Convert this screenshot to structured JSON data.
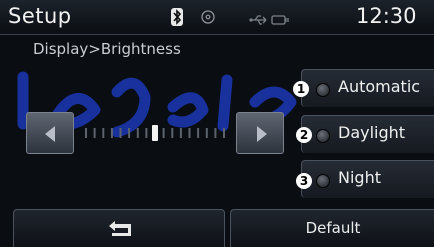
{
  "header": {
    "title": "Setup",
    "clock": "12:30"
  },
  "breadcrumb": "Display>Brightness",
  "options": [
    {
      "badge": "1",
      "label": "Automatic"
    },
    {
      "badge": "2",
      "label": "Daylight"
    },
    {
      "badge": "3",
      "label": "Night"
    }
  ],
  "slider": {
    "level": 0.5
  },
  "footer": {
    "default_label": "Default"
  },
  "icons": {
    "status": [
      "bluetooth-icon",
      "disc-icon",
      "usb-icon",
      "plug-icon"
    ],
    "back": "back-arrow-icon"
  },
  "colors": {
    "background": "#0a0d12",
    "watermark": "#1d3cc8"
  }
}
